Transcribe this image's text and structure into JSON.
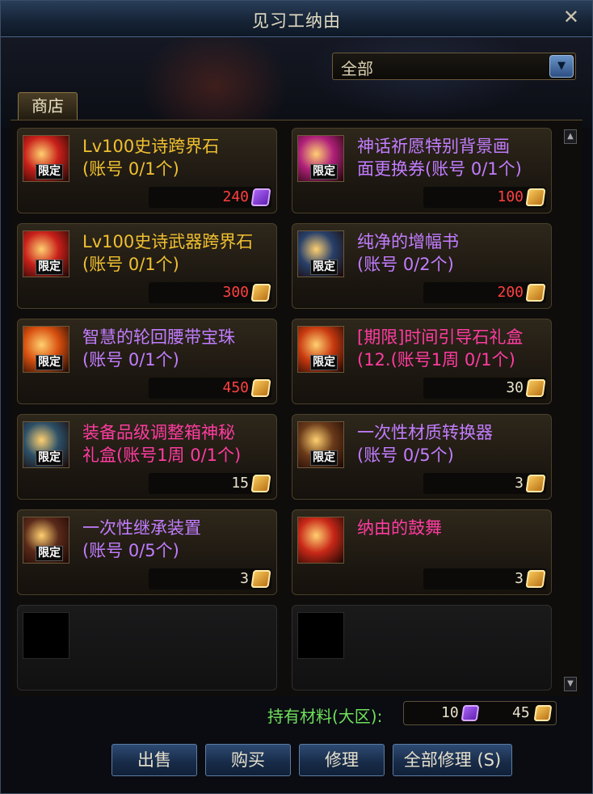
{
  "window": {
    "title": "见习工纳由"
  },
  "filter": {
    "selected": "全部",
    "arrow_icon": "dropdown-arrow-icon"
  },
  "tabs": [
    {
      "label": "商店"
    }
  ],
  "items": [
    {
      "name_line1": "Lv100史诗跨界石",
      "name_line2": "(账号 0/1个)",
      "name_color": "#f0c030",
      "price": "240",
      "price_color": "#ff4040",
      "currency": "purple",
      "limited": true,
      "limited_label": "限定",
      "icon": "epic-cross-stone-icon",
      "icon_color": "#c8201a"
    },
    {
      "name_line1": "神话祈愿特别背景画",
      "name_line2": "面更换券(账号 0/1个)",
      "name_color": "#c27dff",
      "price": "100",
      "price_color": "#ff4040",
      "currency": "gold",
      "limited": true,
      "limited_label": "限定",
      "icon": "myth-wish-ticket-icon",
      "icon_color": "#b0207a"
    },
    {
      "name_line1": "Lv100史诗武器跨界石",
      "name_line2": "(账号 0/1个)",
      "name_color": "#f0c030",
      "price": "300",
      "price_color": "#ff4040",
      "currency": "gold",
      "limited": true,
      "limited_label": "限定",
      "icon": "epic-weapon-cross-stone-icon",
      "icon_color": "#c8201a"
    },
    {
      "name_line1": "纯净的增幅书",
      "name_line2": "(账号 0/2个)",
      "name_color": "#c27dff",
      "price": "200",
      "price_color": "#ff4040",
      "currency": "gold",
      "limited": true,
      "limited_label": "限定",
      "icon": "amplify-book-icon",
      "icon_color": "#28406a"
    },
    {
      "name_line1": "智慧的轮回腰带宝珠",
      "name_line2": "(账号 0/1个)",
      "name_color": "#c27dff",
      "price": "450",
      "price_color": "#ff4040",
      "currency": "gold",
      "limited": true,
      "limited_label": "限定",
      "icon": "belt-orb-icon",
      "icon_color": "#d85010"
    },
    {
      "name_line1": "[期限]时间引导石礼盒",
      "name_line2": "(12.(账号1周 0/1个)",
      "name_color": "#ff3ca0",
      "price": "30",
      "price_color": "#e8e2cc",
      "currency": "gold",
      "limited": true,
      "limited_label": "限定",
      "icon": "time-stone-gift-icon",
      "icon_color": "#c83a10"
    },
    {
      "name_line1": "装备品级调整箱神秘",
      "name_line2": "礼盒(账号1周 0/1个)",
      "name_color": "#ff3ca0",
      "price": "15",
      "price_color": "#e8e2cc",
      "currency": "gold",
      "limited": true,
      "limited_label": "限定",
      "icon": "grade-box-gift-icon",
      "icon_color": "#2c5068"
    },
    {
      "name_line1": "一次性材质转换器",
      "name_line2": "(账号 0/5个)",
      "name_color": "#c27dff",
      "price": "3",
      "price_color": "#e8e2cc",
      "currency": "gold",
      "limited": true,
      "limited_label": "限定",
      "icon": "material-converter-icon",
      "icon_color": "#6a3a1a"
    },
    {
      "name_line1": "一次性继承装置",
      "name_line2": "(账号 0/5个)",
      "name_color": "#c27dff",
      "price": "3",
      "price_color": "#e8e2cc",
      "currency": "gold",
      "limited": true,
      "limited_label": "限定",
      "icon": "inherit-device-icon",
      "icon_color": "#5a2a1a"
    },
    {
      "name_line1": "纳由的鼓舞",
      "name_line2": "",
      "name_color": "#ff3ca0",
      "price": "3",
      "price_color": "#e8e2cc",
      "currency": "gold",
      "limited": false,
      "limited_label": "",
      "icon": "nayu-encouragement-icon",
      "icon_color": "#c82818"
    },
    {
      "name_line1": "",
      "name_line2": "",
      "name_color": "#c27dff",
      "price": "",
      "price_color": "#e8e2cc",
      "currency": "",
      "limited": false,
      "limited_label": "",
      "icon": "empty-slot-icon",
      "icon_color": "#000000",
      "empty": true
    },
    {
      "name_line1": "",
      "name_line2": "",
      "name_color": "#c27dff",
      "price": "",
      "price_color": "#e8e2cc",
      "currency": "",
      "limited": false,
      "limited_label": "",
      "icon": "empty-slot-icon",
      "icon_color": "#000000",
      "empty": true
    }
  ],
  "holdings": {
    "label": "持有材料(大区):",
    "purple_amount": "10",
    "gold_amount": "45"
  },
  "buttons": {
    "sell": "出售",
    "buy": "购买",
    "repair": "修理",
    "repair_all": "全部修理 (S)"
  }
}
